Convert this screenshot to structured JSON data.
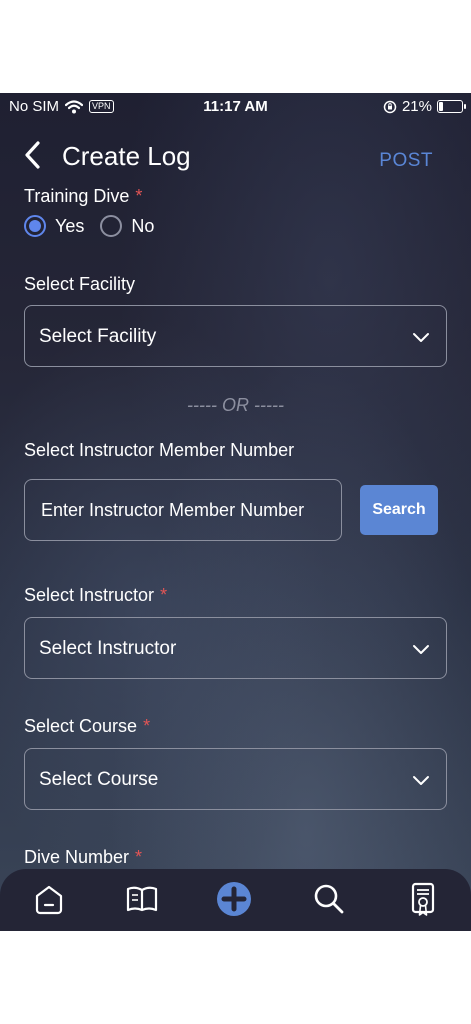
{
  "status_bar": {
    "carrier": "No SIM",
    "vpn": "VPN",
    "time": "11:17 AM",
    "battery": "21%",
    "battery_level": 0.21
  },
  "header": {
    "title": "Create Log",
    "post_label": "POST"
  },
  "training_dive": {
    "label": "Training Dive",
    "required_mark": "*",
    "options": [
      "Yes",
      "No"
    ],
    "selected": "Yes"
  },
  "facility": {
    "label": "Select Facility",
    "value": "Select Facility"
  },
  "or_divider": "----- OR -----",
  "instructor_number": {
    "label": "Select Instructor Member Number",
    "placeholder": "Enter Instructor Member Number",
    "search_label": "Search"
  },
  "instructor": {
    "label": "Select Instructor",
    "required_mark": "*",
    "value": "Select Instructor"
  },
  "course": {
    "label": "Select Course",
    "required_mark": "*",
    "value": "Select Course"
  },
  "dive_number": {
    "label": "Dive Number",
    "required_mark": "*"
  },
  "nav": {
    "items": [
      "home-icon",
      "book-icon",
      "add-icon",
      "search-icon",
      "certificate-icon"
    ],
    "active": "add-icon",
    "accent": "#5b86d4"
  },
  "colors": {
    "accent": "#5b86d4",
    "required": "#e25555",
    "divider_text": "#8c8f9f"
  }
}
